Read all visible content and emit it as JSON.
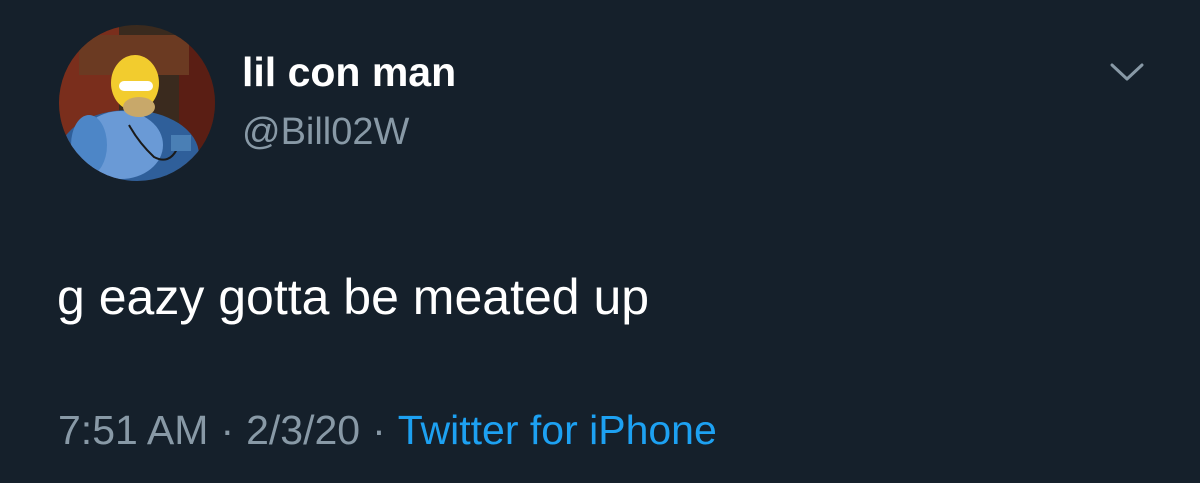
{
  "tweet": {
    "display_name": "lil con man",
    "handle": "@Bill02W",
    "text": "g eazy gotta be meated up",
    "time": "7:51 AM",
    "separator": "·",
    "date": "2/3/20",
    "source": "Twitter for iPhone"
  },
  "icons": {
    "avatar": "avatar-image",
    "menu": "chevron-down-icon"
  },
  "colors": {
    "background": "#15202b",
    "primary_text": "#ffffff",
    "secondary_text": "#8899a6",
    "link": "#1da1f2"
  }
}
